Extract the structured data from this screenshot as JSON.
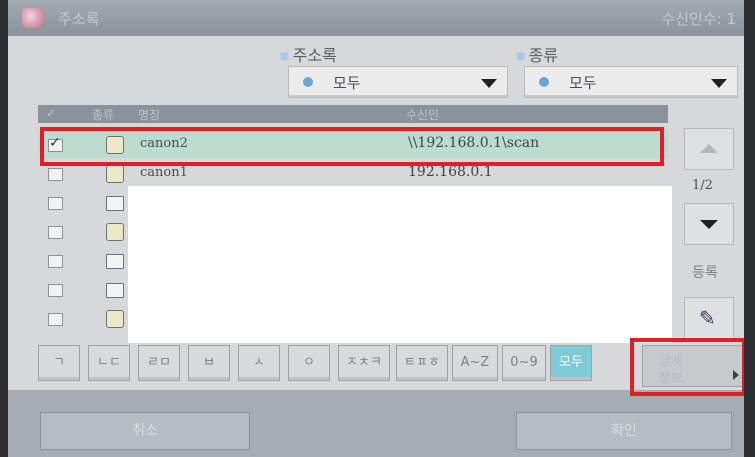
{
  "title_bar": {
    "title": "주소록",
    "recipient_count": "수신인수:  1"
  },
  "filters": {
    "address_book": {
      "label": "주소록",
      "value": "모두"
    },
    "type": {
      "label": "종류",
      "value": "모두"
    }
  },
  "table": {
    "columns": [
      "✓",
      "종류",
      "명칭",
      "수신인"
    ],
    "rows": [
      {
        "name": "canon2",
        "address": "\\\\192.168.0.1\\scan",
        "checked": true,
        "type_icon": "address-book-icon"
      },
      {
        "name": "canon1",
        "address": "192.168.0.1",
        "checked": false,
        "type_icon": "address-book-icon"
      },
      {
        "name": "",
        "address": "",
        "checked": false,
        "type_icon": "fax-icon"
      },
      {
        "name": "",
        "address": "",
        "checked": false,
        "type_icon": "address-book-icon"
      },
      {
        "name": "",
        "address": "",
        "checked": false,
        "type_icon": "fax-icon"
      },
      {
        "name": "",
        "address": "",
        "checked": false,
        "type_icon": "fax-icon"
      },
      {
        "name": "",
        "address": "",
        "checked": false,
        "type_icon": "address-book-icon"
      }
    ]
  },
  "pager": {
    "page": "1/2"
  },
  "register": {
    "label": "등록"
  },
  "index_buttons": [
    "ㄱ",
    "ㄴㄷ",
    "ㄹㅁ",
    "ㅂ",
    "ㅅ",
    "ㅇ",
    "ㅈㅊㅋ",
    "ㅌㅍㅎ",
    "A~Z",
    "0~9",
    "모두"
  ],
  "detail_button": {
    "line1": "상세",
    "line2": "정보"
  },
  "bottom": {
    "cancel": "취소",
    "ok": "확인"
  },
  "colors": {
    "highlight_red": "#e21d25",
    "selected_row": "#bcdcd0",
    "active_index": "#7fcad8"
  }
}
